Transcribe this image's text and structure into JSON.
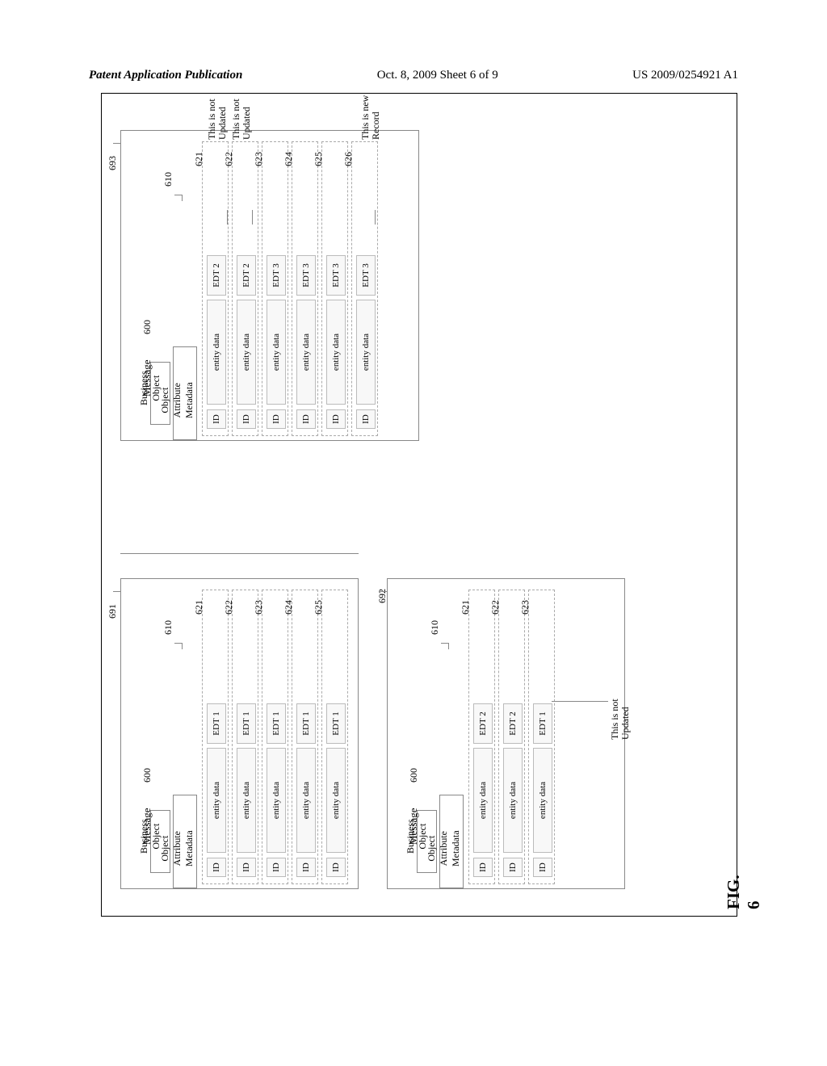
{
  "header": {
    "left": "Patent Application Publication",
    "center": "Oct. 8, 2009  Sheet 6 of 9",
    "right": "US 2009/0254921 A1"
  },
  "figLabel": "FIG. 6",
  "labels": {
    "message": "Message",
    "bo": "Business\nObject",
    "oam": "Object Attribute\nMetadata",
    "id": "ID",
    "ed": "entity data",
    "boxNum": "600",
    "oamNum": "610"
  },
  "annots": {
    "notUpdated": "This is not\nUpdated",
    "newRecord": "This is new\nRecord"
  },
  "panels": {
    "p691": {
      "ref": "691",
      "rowNums": [
        "621",
        "622",
        "623",
        "624",
        "625"
      ],
      "edts": [
        "EDT 1",
        "EDT 1",
        "EDT 1",
        "EDT 1",
        "EDT 1"
      ]
    },
    "p692": {
      "ref": "692",
      "rowNums": [
        "621",
        "622",
        "623"
      ],
      "edts": [
        "EDT 2",
        "EDT 2",
        "EDT 1"
      ]
    },
    "p693": {
      "ref": "693",
      "rowNums": [
        "621",
        "622",
        "623",
        "624",
        "625",
        "626"
      ],
      "edts": [
        "EDT 2",
        "EDT 2",
        "EDT 3",
        "EDT 3",
        "EDT 3",
        "EDT 3"
      ]
    }
  }
}
